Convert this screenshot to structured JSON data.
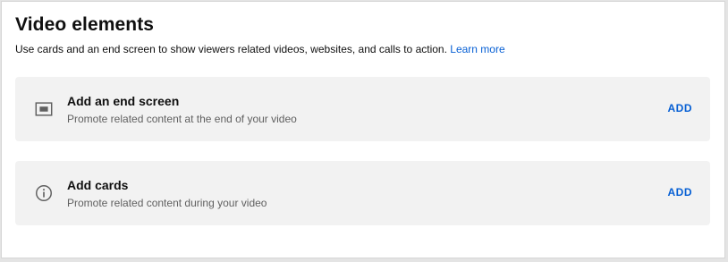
{
  "section": {
    "title": "Video elements",
    "description": "Use cards and an end screen to show viewers related videos, websites, and calls to action.",
    "learn_more": "Learn more"
  },
  "items": [
    {
      "title": "Add an end screen",
      "description": "Promote related content at the end of your video",
      "action": "ADD",
      "icon": "end-screen-icon"
    },
    {
      "title": "Add cards",
      "description": "Promote related content during your video",
      "action": "ADD",
      "icon": "info-icon"
    }
  ],
  "colors": {
    "accent": "#065fd4",
    "card_background": "#f2f2f2",
    "secondary_text": "#606060"
  }
}
